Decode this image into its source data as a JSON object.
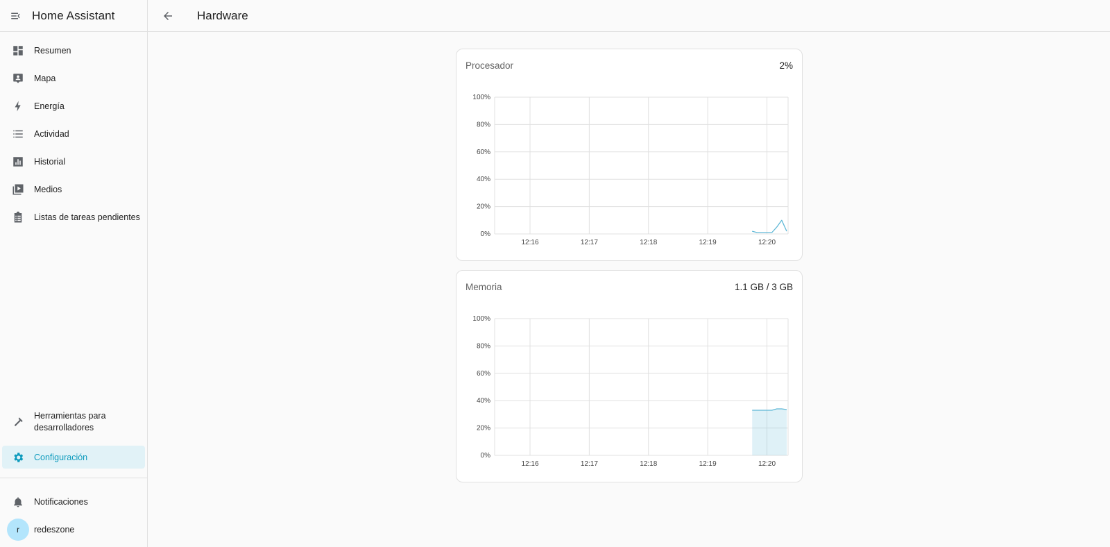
{
  "app": {
    "title": "Home Assistant"
  },
  "page": {
    "title": "Hardware"
  },
  "sidebar": {
    "items": [
      {
        "label": "Resumen",
        "icon": "dashboard-icon"
      },
      {
        "label": "Mapa",
        "icon": "map-icon"
      },
      {
        "label": "Energía",
        "icon": "lightning-icon"
      },
      {
        "label": "Actividad",
        "icon": "list-icon"
      },
      {
        "label": "Historial",
        "icon": "chart-icon"
      },
      {
        "label": "Medios",
        "icon": "media-icon"
      },
      {
        "label": "Listas de tareas pendientes",
        "icon": "clipboard-icon"
      }
    ],
    "dev_tools": {
      "label": "Herramientas para desarrolladores",
      "icon": "hammer-icon"
    },
    "config": {
      "label": "Configuración",
      "icon": "gear-icon"
    },
    "notifications": {
      "label": "Notificaciones",
      "icon": "bell-icon"
    },
    "user": {
      "name": "redeszone",
      "initial": "r"
    },
    "accent_color": "#0e9bbd"
  },
  "cards": {
    "cpu": {
      "title": "Procesador",
      "value": "2%"
    },
    "memory": {
      "title": "Memoria",
      "value": "1.1 GB / 3 GB"
    }
  },
  "chart_data": [
    {
      "type": "line",
      "y_ticks": [
        "0%",
        "20%",
        "40%",
        "60%",
        "80%",
        "100%"
      ],
      "x_ticks": [
        "12:16",
        "12:17",
        "12:18",
        "12:19",
        "12:20"
      ],
      "ylim": [
        0,
        100
      ],
      "grid": true,
      "color": "#5fb8d6",
      "x": [
        "12:19:45",
        "12:19:50",
        "12:19:55",
        "12:20:00",
        "12:20:05",
        "12:20:10",
        "12:20:15",
        "12:20:20"
      ],
      "y": [
        2,
        1,
        1,
        1,
        1,
        5,
        10,
        2
      ]
    },
    {
      "type": "area",
      "y_ticks": [
        "0%",
        "20%",
        "40%",
        "60%",
        "80%",
        "100%"
      ],
      "x_ticks": [
        "12:16",
        "12:17",
        "12:18",
        "12:19",
        "12:20"
      ],
      "ylim": [
        0,
        100
      ],
      "grid": true,
      "color": "#5fb8d6",
      "x": [
        "12:19:45",
        "12:19:55",
        "12:20:05",
        "12:20:10",
        "12:20:15",
        "12:20:20"
      ],
      "y": [
        33,
        33,
        33,
        34,
        34,
        33.5
      ]
    }
  ]
}
